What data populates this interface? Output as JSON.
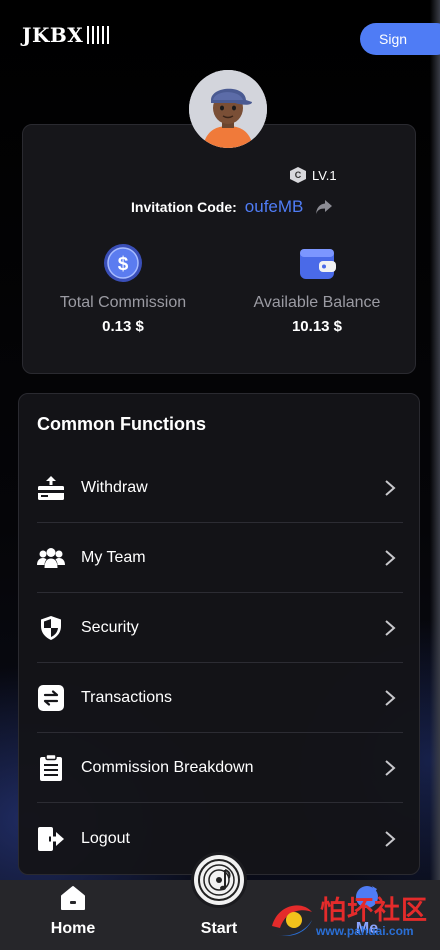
{
  "header": {
    "logo_text": "JKBX",
    "sign_label": "Sign"
  },
  "profile": {
    "level": "LV.1",
    "invitation_label": "Invitation Code:",
    "invitation_code": "oufeMB",
    "total_commission_label": "Total Commission",
    "total_commission_value": "0.13 $",
    "available_balance_label": "Available Balance",
    "available_balance_value": "10.13 $"
  },
  "functions": {
    "title": "Common Functions",
    "items": [
      {
        "label": "Withdraw",
        "icon": "withdraw-icon"
      },
      {
        "label": "My Team",
        "icon": "team-icon"
      },
      {
        "label": "Security",
        "icon": "shield-icon"
      },
      {
        "label": "Transactions",
        "icon": "transfer-icon"
      },
      {
        "label": "Commission Breakdown",
        "icon": "clipboard-icon"
      },
      {
        "label": "Logout",
        "icon": "logout-icon"
      }
    ]
  },
  "nav": {
    "home_label": "Home",
    "start_label": "Start",
    "me_label": "Me"
  },
  "watermark": {
    "brand": "怕坏社区",
    "url": "www.pahuai.com"
  },
  "colors": {
    "accent": "#4f7cf5",
    "card_bg": "#16161a",
    "nav_bg": "#26262a",
    "watermark_red": "#e42b2b"
  }
}
